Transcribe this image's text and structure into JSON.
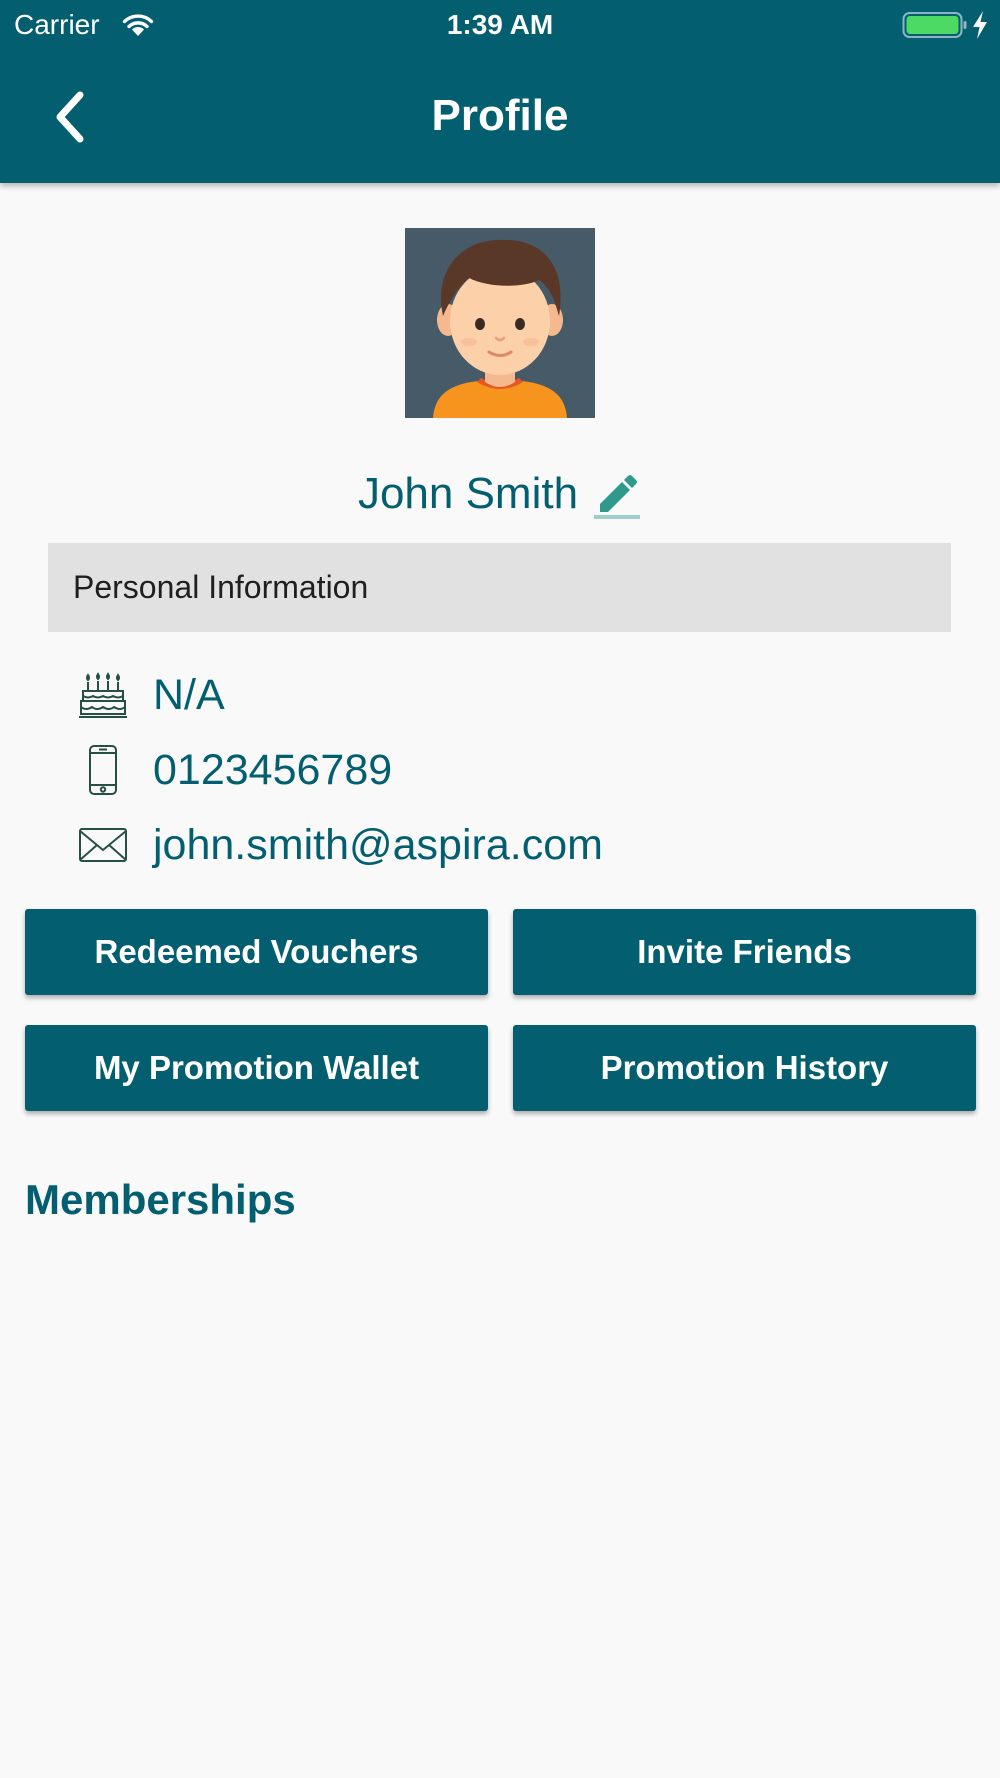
{
  "status_bar": {
    "carrier": "Carrier",
    "time": "1:39 AM",
    "icons": [
      "wifi-icon",
      "battery-icon",
      "charging-bolt-icon"
    ]
  },
  "nav": {
    "title": "Profile",
    "back_icon": "chevron-left-icon"
  },
  "profile": {
    "name": "John Smith",
    "edit_icon": "pencil-icon"
  },
  "personal_info": {
    "header": "Personal Information",
    "items": [
      {
        "icon": "birthday-cake-icon",
        "value": "N/A"
      },
      {
        "icon": "mobile-phone-icon",
        "value": "0123456789"
      },
      {
        "icon": "envelope-icon",
        "value": "john.smith@aspira.com"
      }
    ]
  },
  "actions": {
    "redeemed_vouchers": "Redeemed Vouchers",
    "invite_friends": "Invite Friends",
    "promotion_wallet": "My Promotion Wallet",
    "promotion_history": "Promotion History"
  },
  "memberships": {
    "title": "Memberships"
  },
  "colors": {
    "primary": "#035f70",
    "background": "#f9f9fa",
    "section_header_bg": "#e1e1e1",
    "edit_icon": "#2f9a8c",
    "battery_fill": "#4cd964"
  }
}
